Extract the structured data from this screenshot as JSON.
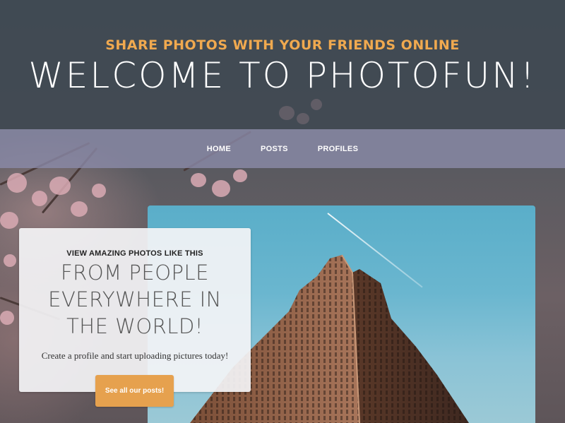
{
  "header": {
    "tagline": "SHARE PHOTOS WITH YOUR FRIENDS ONLINE",
    "title": "WELCOME TO PHOTOFUN!"
  },
  "nav": {
    "items": [
      {
        "label": "HOME"
      },
      {
        "label": "POSTS"
      },
      {
        "label": "PROFILES"
      }
    ]
  },
  "feature": {
    "eyebrow": "VIEW AMAZING PHOTOS LIKE THIS",
    "heading_line1": "FROM PEOPLE",
    "heading_line2": "EVERYWHERE IN",
    "heading_line3": "THE WORLD!",
    "text": "Create a profile and start uploading pictures today!",
    "button_label": "See all our posts!"
  },
  "colors": {
    "accent": "#e6a14e",
    "header_overlay": "#3a444d",
    "nav_overlay": "#8c8caa"
  }
}
